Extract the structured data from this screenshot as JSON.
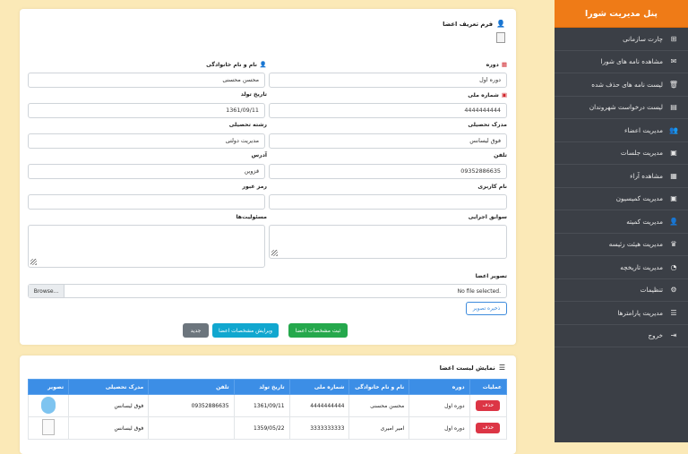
{
  "sidebar": {
    "title": "پنل مدیریت شورا",
    "items": [
      {
        "label": "چارت سازمانی",
        "icon": "sitemap-icon",
        "glyph": "⊞"
      },
      {
        "label": "مشاهده نامه های شورا",
        "icon": "envelope-icon",
        "glyph": "✉"
      },
      {
        "label": "لیست نامه های حذف شده",
        "icon": "trash-icon",
        "glyph": "🗑"
      },
      {
        "label": "لیست درخواست شهروندان",
        "icon": "file-icon",
        "glyph": "▤"
      },
      {
        "label": "مدیریت اعضاء",
        "icon": "users-icon",
        "glyph": "👥"
      },
      {
        "label": "مدیریت جلسات",
        "icon": "meeting-icon",
        "glyph": "▣"
      },
      {
        "label": "مشاهده آراء",
        "icon": "vote-icon",
        "glyph": "▦"
      },
      {
        "label": "مدیریت کمیسیون",
        "icon": "commission-icon",
        "glyph": "▣"
      },
      {
        "label": "مدیریت کمیته",
        "icon": "committee-icon",
        "glyph": "👤"
      },
      {
        "label": "مدیریت هیئت رئیسه",
        "icon": "crown-icon",
        "glyph": "♛"
      },
      {
        "label": "مدیریت تاریخچه",
        "icon": "clock-icon",
        "glyph": "◔"
      },
      {
        "label": "تنظیمات",
        "icon": "gears-icon",
        "glyph": "⚙"
      },
      {
        "label": "مدیریت پارامترها",
        "icon": "sliders-icon",
        "glyph": "☰"
      },
      {
        "label": "خروج",
        "icon": "logout-icon",
        "glyph": "⇥"
      }
    ]
  },
  "form": {
    "title": "فرم تعریف اعضا",
    "period_label": "دوره",
    "period_value": "دوره اول",
    "name_label": "نام و نام خانوادگی",
    "name_value": "محسن محسنی",
    "national_id_label": "شماره ملی",
    "national_id_value": "4444444444",
    "birthdate_label": "تاریخ تولد",
    "birthdate_value": "1361/09/11",
    "degree_label": "مدرک تحصیلی",
    "degree_value": "فوق لیسانس",
    "field_label": "رشته تحصیلی",
    "field_value": "مدیریت دولتی",
    "phone_label": "تلفن",
    "phone_value": "09352886635",
    "address_label": "آدرس",
    "address_value": "قزوین",
    "username_label": "نام کاربری",
    "username_value": "",
    "password_label": "رمز عبور",
    "password_value": "",
    "history_label": "سوابق اجرایی",
    "duties_label": "مسئولیت‌ها",
    "image_label": "تصویر اعضا",
    "browse_label": "Browse...",
    "no_file_label": "No file selected.",
    "save_image_label": "ذخیره تصویر",
    "register_label": "ثبت مشخصات اعضا",
    "edit_label": "ویرایش مشخصات اعضا",
    "new_label": "جدید"
  },
  "list": {
    "title": "نمایش لیست اعضا",
    "columns": [
      "عملیات",
      "دوره",
      "نام و نام خانوادگی",
      "شماره ملی",
      "تاریخ تولد",
      "تلفن",
      "مدرک تحصیلی",
      "تصویر"
    ],
    "delete_label": "حذف",
    "rows": [
      {
        "period": "دوره اول",
        "name": "محسن محسنی",
        "national_id": "4444444444",
        "birthdate": "1361/09/11",
        "phone": "09352886635",
        "degree": "فوق لیسانس",
        "image": "avatar"
      },
      {
        "period": "دوره اول",
        "name": "امیر امیری",
        "national_id": "3333333333",
        "birthdate": "1359/05/22",
        "phone": "",
        "degree": "فوق لیسانس",
        "image": "thumb"
      }
    ]
  }
}
